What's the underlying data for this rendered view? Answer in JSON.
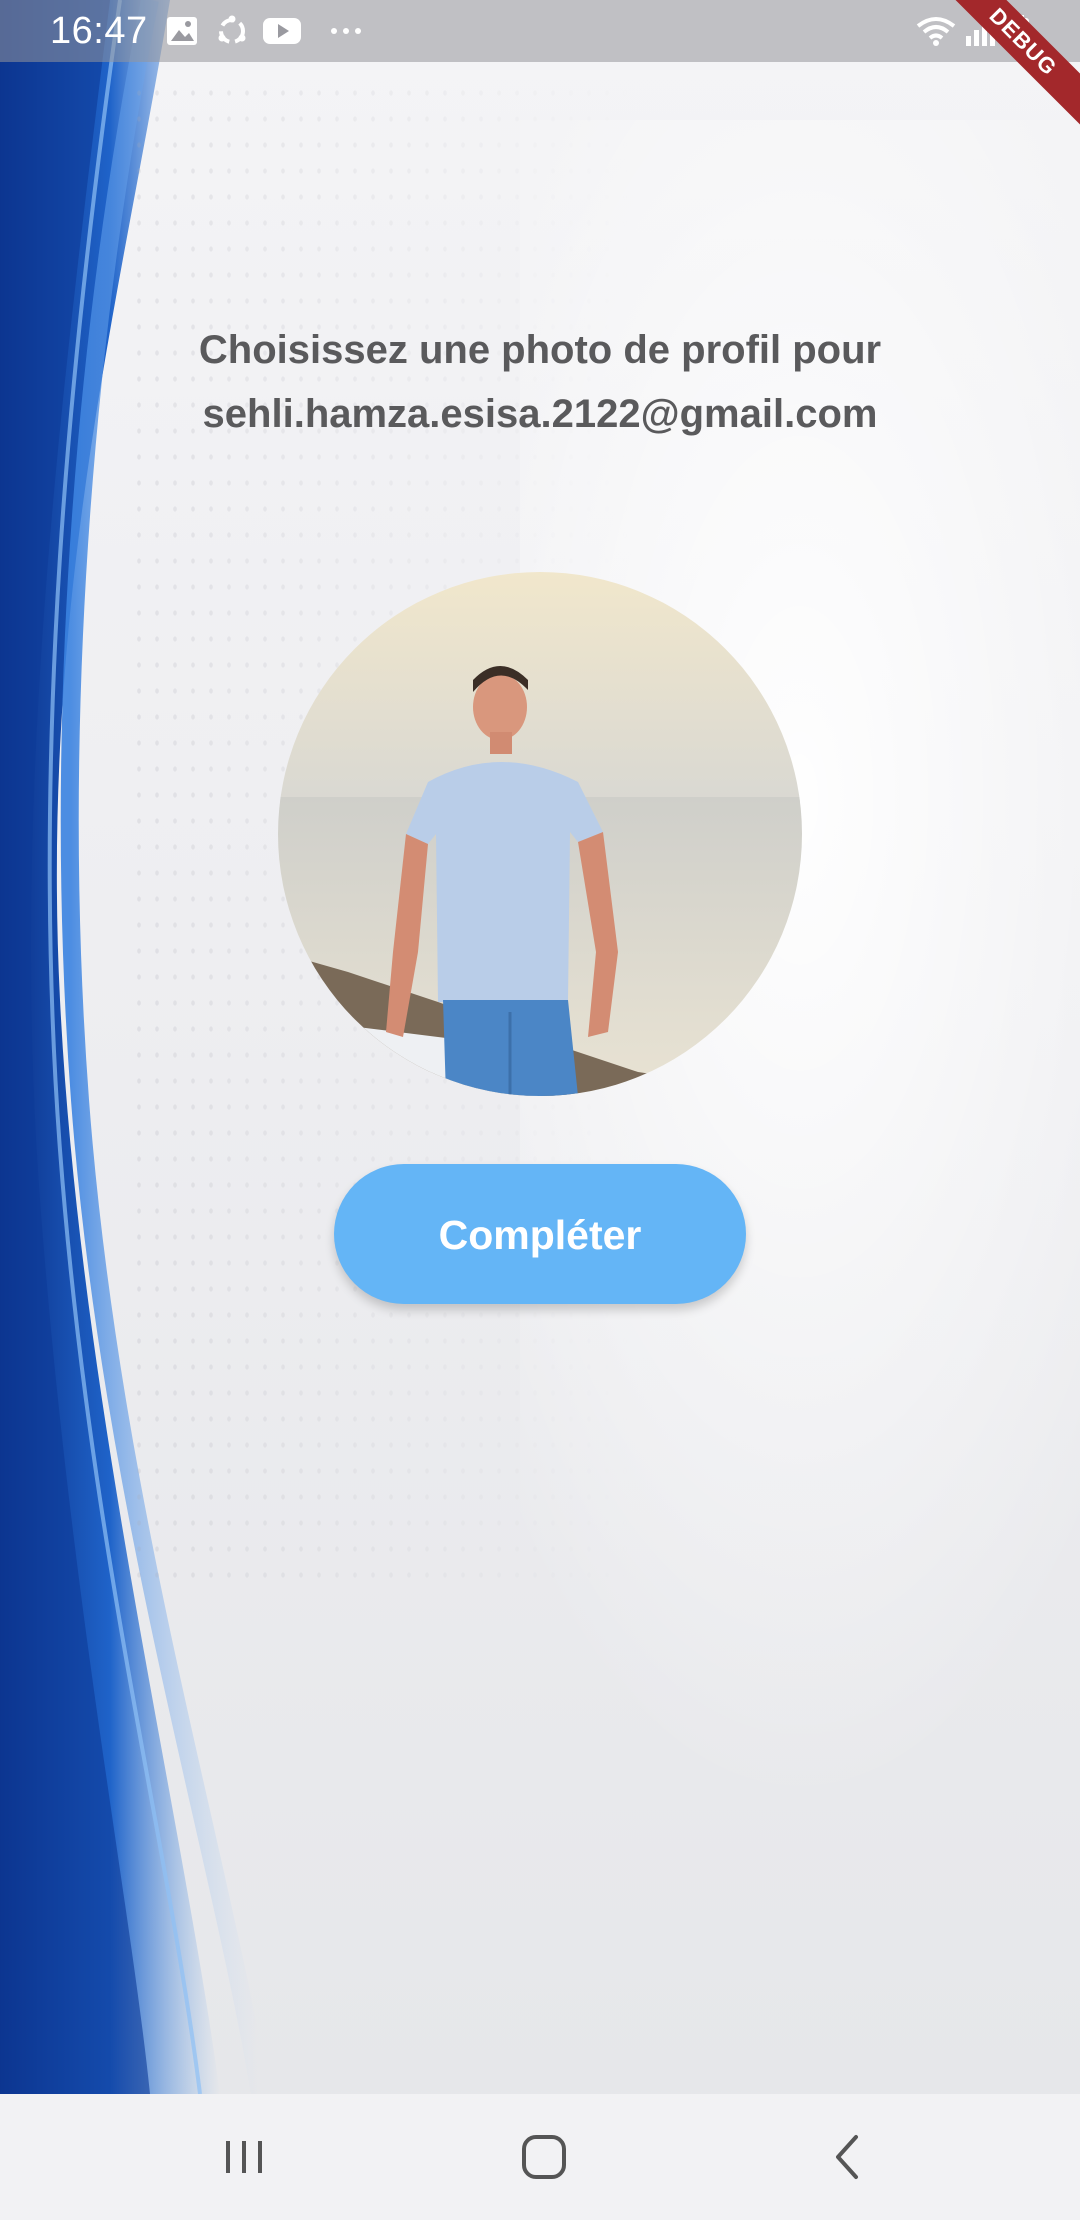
{
  "status_bar": {
    "time": "16:47",
    "left_icons": [
      "gallery-icon",
      "sync-icon",
      "youtube-icon",
      "more-dots-icon"
    ],
    "right_icons": [
      "wifi-icon",
      "signal-icon",
      "battery-charging-icon"
    ],
    "debug_label": "DEBUG"
  },
  "page": {
    "title_line1": "Choisissez une photo de profil pour",
    "title_line2": "sehli.hamza.esisa.2122@gmail.com"
  },
  "profile_photo": {
    "alt": "profile photo"
  },
  "actions": {
    "complete_label": "Compléter"
  },
  "nav_bar": {
    "items": [
      "recents-icon",
      "home-icon",
      "back-icon"
    ]
  },
  "colors": {
    "button": "#64b5f6",
    "title": "#5a5a5c",
    "debug_ribbon": "#a3282b"
  }
}
